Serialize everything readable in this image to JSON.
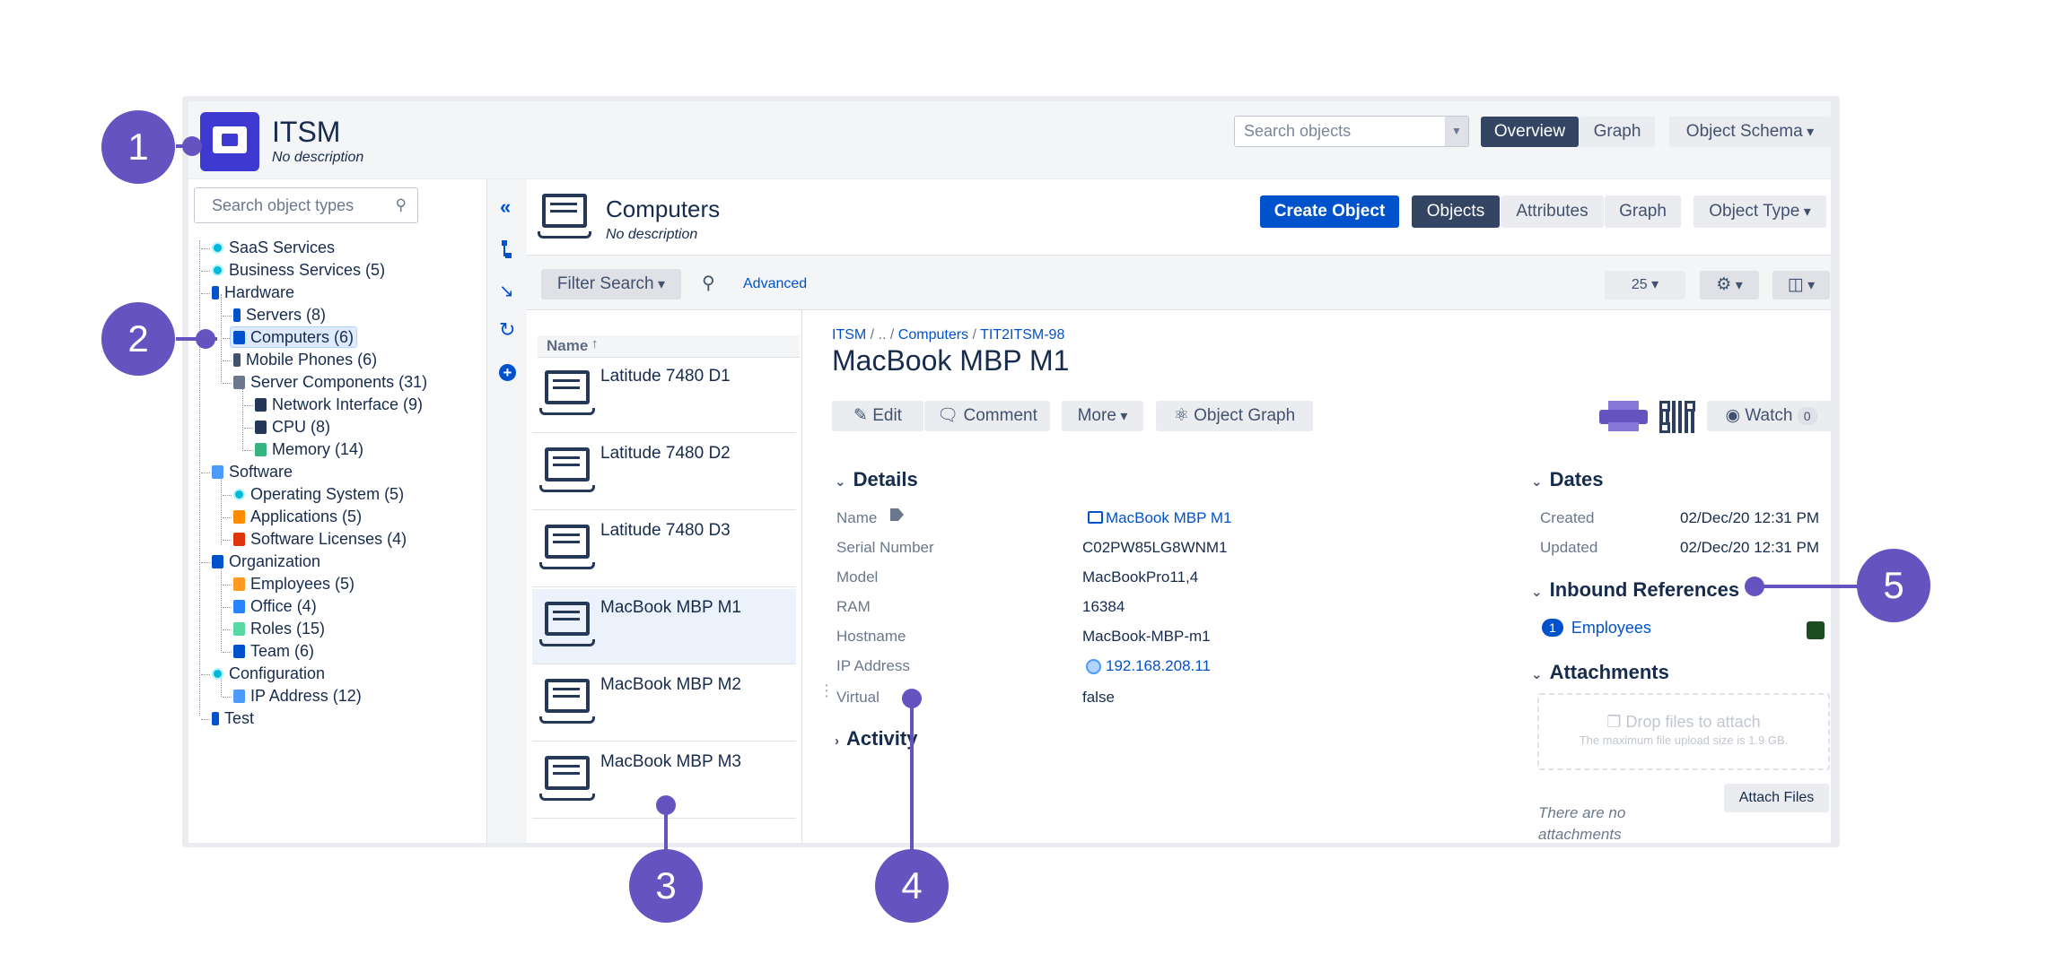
{
  "header": {
    "app_title": "ITSM",
    "app_description": "No description",
    "search_placeholder": "Search objects",
    "tabs": [
      "Overview",
      "Graph"
    ],
    "schema_menu": "Object Schema"
  },
  "sidebar": {
    "search_placeholder": "Search object types",
    "tree": [
      {
        "label": "SaaS Services"
      },
      {
        "label": "Business Services (5)"
      },
      {
        "label": "Hardware"
      },
      {
        "label": "Servers (8)"
      },
      {
        "label": "Computers (6)"
      },
      {
        "label": "Mobile Phones (6)"
      },
      {
        "label": "Server Components (31)"
      },
      {
        "label": "Network Interface (9)"
      },
      {
        "label": "CPU (8)"
      },
      {
        "label": "Memory (14)"
      },
      {
        "label": "Software"
      },
      {
        "label": "Operating System (5)"
      },
      {
        "label": "Applications (5)"
      },
      {
        "label": "Software Licenses (4)"
      },
      {
        "label": "Organization"
      },
      {
        "label": "Employees (5)"
      },
      {
        "label": "Office (4)"
      },
      {
        "label": "Roles (15)"
      },
      {
        "label": "Team (6)"
      },
      {
        "label": "Configuration"
      },
      {
        "label": "IP Address (12)"
      },
      {
        "label": "Test"
      }
    ]
  },
  "type_header": {
    "title": "Computers",
    "description": "No description",
    "create_button": "Create Object",
    "tabs": [
      "Objects",
      "Attributes",
      "Graph"
    ],
    "type_menu": "Object Type"
  },
  "filter": {
    "filter_button": "Filter Search",
    "advanced": "Advanced",
    "page_size": "25"
  },
  "list": {
    "column_header": "Name",
    "items": [
      "Latitude 7480 D1",
      "Latitude 7480 D2",
      "Latitude 7480 D3",
      "MacBook MBP M1",
      "MacBook MBP M2",
      "MacBook MBP M3"
    ]
  },
  "detail": {
    "breadcrumb": {
      "root": "ITSM",
      "sep1": "/ .. /",
      "type": "Computers",
      "sep2": "/",
      "key": "TIT2ITSM-98"
    },
    "title": "MacBook MBP M1",
    "actions": {
      "edit": "Edit",
      "comment": "Comment",
      "more": "More",
      "graph": "Object Graph",
      "watch": "Watch",
      "watch_count": "0"
    },
    "details_heading": "Details",
    "attributes": [
      {
        "label": "Name",
        "value": "MacBook MBP M1"
      },
      {
        "label": "Serial Number",
        "value": "C02PW85LG8WNM1"
      },
      {
        "label": "Model",
        "value": "MacBookPro11,4"
      },
      {
        "label": "RAM",
        "value": "16384"
      },
      {
        "label": "Hostname",
        "value": "MacBook-MBP-m1"
      },
      {
        "label": "IP Address",
        "value": "192.168.208.11"
      },
      {
        "label": "Virtual",
        "value": "false"
      }
    ],
    "activity_heading": "Activity",
    "dates_heading": "Dates",
    "created_label": "Created",
    "created_value": "02/Dec/20 12:31 PM",
    "updated_label": "Updated",
    "updated_value": "02/Dec/20 12:31 PM",
    "inbound_heading": "Inbound References",
    "inbound_count": "1",
    "inbound_label": "Employees",
    "attachments_heading": "Attachments",
    "drop_text": "Drop files to attach",
    "drop_hint": "The maximum file upload size is 1.9 GB.",
    "attach_button": "Attach Files",
    "no_attachments": "There are no attachments"
  },
  "callouts": [
    "1",
    "2",
    "3",
    "4",
    "5"
  ],
  "colors": {
    "accent": "#6554c0",
    "primary": "#0052cc",
    "dark": "#344563"
  }
}
